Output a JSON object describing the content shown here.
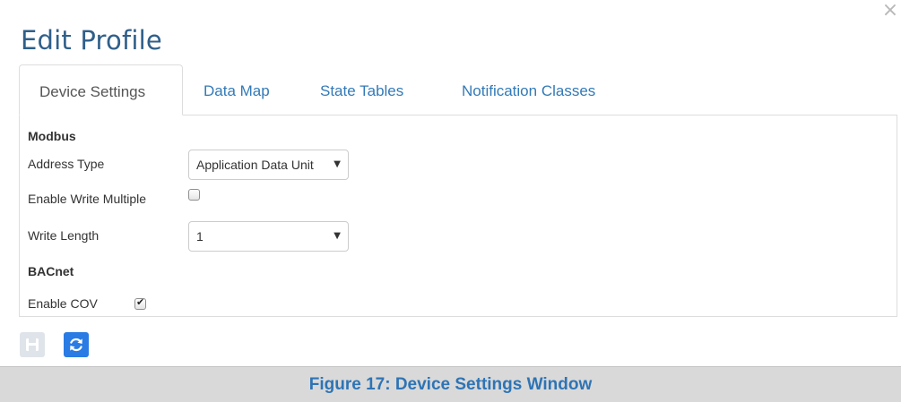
{
  "dialog": {
    "title": "Edit Profile",
    "close_glyph": "×"
  },
  "tabs": [
    {
      "label": "Device Settings",
      "active": true
    },
    {
      "label": "Data Map",
      "active": false
    },
    {
      "label": "State Tables",
      "active": false
    },
    {
      "label": "Notification Classes",
      "active": false
    }
  ],
  "modbus": {
    "heading": "Modbus",
    "address_type_label": "Address Type",
    "address_type_value": "Application Data Unit",
    "enable_write_multiple_label": "Enable Write Multiple",
    "enable_write_multiple_checked": false,
    "write_length_label": "Write Length",
    "write_length_value": "1"
  },
  "bacnet": {
    "heading": "BACnet",
    "enable_cov_label": "Enable COV",
    "enable_cov_checked": true
  },
  "toolbar": {
    "save_icon": "floppy-disk-icon",
    "refresh_icon": "refresh-icon"
  },
  "colors": {
    "title": "#2f5f8a",
    "tab_link": "#337ab7",
    "refresh_button": "#2a7be3",
    "caption_text": "#2e74b5"
  },
  "caption": "Figure 17: Device Settings Window"
}
